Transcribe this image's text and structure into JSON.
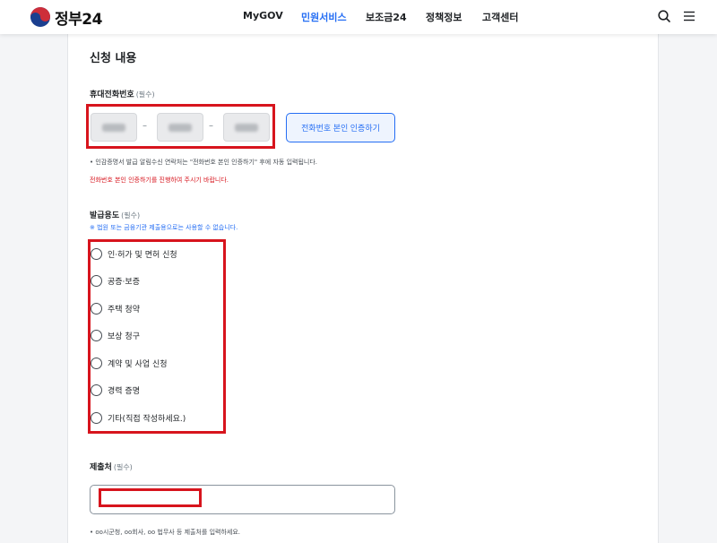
{
  "header": {
    "logo_text": "정부24",
    "nav": [
      {
        "label": "MyGOV",
        "active": false
      },
      {
        "label": "민원서비스",
        "active": true
      },
      {
        "label": "보조금24",
        "active": false
      },
      {
        "label": "정책정보",
        "active": false
      },
      {
        "label": "고객센터",
        "active": false
      }
    ],
    "icons": [
      "search-icon",
      "menu-icon"
    ],
    "accent_color": "#256ef4"
  },
  "form": {
    "section_title": "신청 내용",
    "phone": {
      "label": "휴대전화번호",
      "required": "(필수)",
      "separator": "–",
      "verify_button": "전화번호 본인 인증하기",
      "note": "• 인감증명서 발급 알림수신 연락처는 \"전화번호 본인 인증하기\" 후에 자동 입력됩니다.",
      "warning": "전화번호 본인 인증하기를 진행하여 주시기 바랍니다."
    },
    "purpose": {
      "label": "발급용도",
      "required": "(필수)",
      "note": "※ 법원 또는 금융기관 제출용으로는 사용할 수 없습니다.",
      "options": [
        "인·허가 및 면허 신청",
        "공증·보증",
        "주택 청약",
        "보상 청구",
        "계약 및 사업 신청",
        "경력 증명",
        "기타(직접 작성하세요.)"
      ]
    },
    "submit_to": {
      "label": "제출처",
      "required": "(필수)",
      "value": "",
      "note": "• oo시군청, oo회사, oo 법무사 등 제출처를 입력하세요."
    },
    "highlight_color": "#d7141d"
  }
}
